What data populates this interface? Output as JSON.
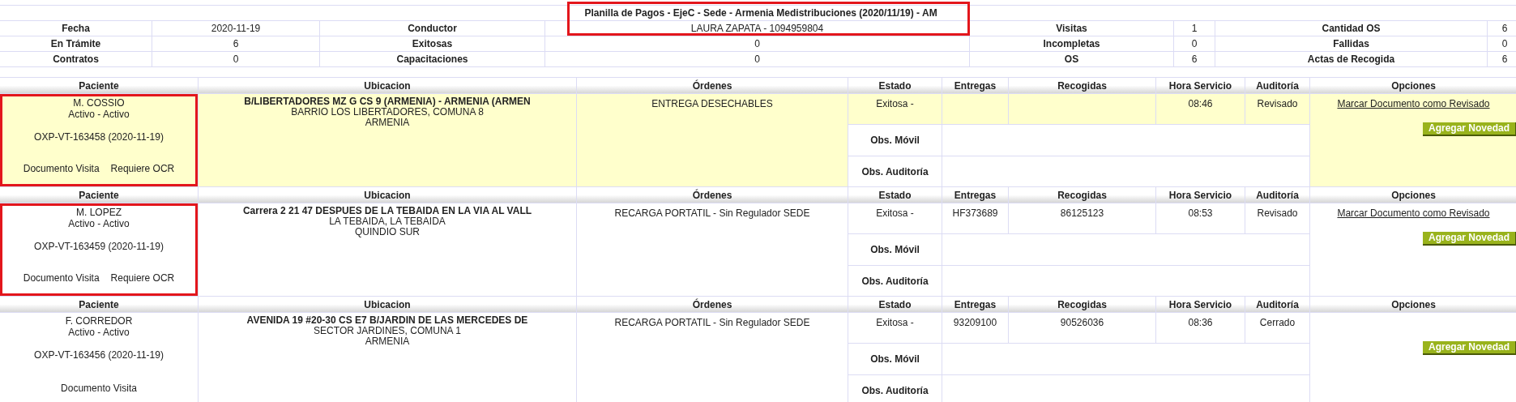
{
  "summary": {
    "title": "Planilla de Pagos - EjeC - Sede - Armenia Medistribuciones (2020/11/19) - AM",
    "flagged": true,
    "rows": [
      [
        {
          "label": "Fecha",
          "value": "2020-11-19"
        },
        {
          "label": "Conductor",
          "value": "LAURA ZAPATA - 1094959804"
        },
        {
          "label": "Visitas",
          "value": "1"
        },
        {
          "label": "Cantidad OS",
          "value": "6"
        }
      ],
      [
        {
          "label": "En Trámite",
          "value": "6"
        },
        {
          "label": "Exitosas",
          "value": "0"
        },
        {
          "label": "Incompletas",
          "value": "0"
        },
        {
          "label": "Fallidas",
          "value": "0"
        }
      ],
      [
        {
          "label": "Contratos",
          "value": "0"
        },
        {
          "label": "Capacitaciones",
          "value": "0"
        },
        {
          "label": "OS",
          "value": "6"
        },
        {
          "label": "Actas de Recogida",
          "value": "6"
        }
      ]
    ]
  },
  "records": [
    {
      "selected": true,
      "flagged": true,
      "columns": [
        "Paciente",
        "Ubicacion",
        "Órdenes",
        "Estado",
        "Entregas",
        "Recogidas",
        "Hora Servicio",
        "Auditoría",
        "Opciones"
      ],
      "patient": {
        "name": "M. COSSIO",
        "status": "Activo - Activo",
        "code": "OXP-VT-163458 (2020-11-19)",
        "documents": [
          "Documento Visita",
          "Requiere OCR"
        ]
      },
      "address": [
        "B/LIBERTADORES MZ G CS 9 (ARMENIA) - ARMENIA (ARMEN",
        "BARRIO LOS LIBERTADORES, COMUNA 8",
        "ARMENIA"
      ],
      "order": "ENTREGA DESECHABLES",
      "estado": "Exitosa -",
      "hora": "08:46",
      "auditoria": "Revisado",
      "obs_labels": [
        "Obs. Móvil",
        "Obs. Auditoría"
      ],
      "link": "Marcar Documento como Revisado",
      "button": "Agregar Novedad"
    },
    {
      "selected": false,
      "flagged": true,
      "columns": [
        "Paciente",
        "Ubicacion",
        "Órdenes",
        "Estado",
        "Entregas",
        "Recogidas",
        "Hora Servicio",
        "Auditoría",
        "Opciones"
      ],
      "patient": {
        "name": "M. LOPEZ",
        "status": "Activo - Activo",
        "code": "OXP-VT-163459 (2020-11-19)",
        "documents": [
          "Documento Visita",
          "Requiere OCR"
        ]
      },
      "address": [
        "Carrera 2 21 47 DESPUES DE LA TEBAIDA EN LA VIA AL VALL",
        "LA TEBAIDA, LA TEBAIDA",
        "QUINDIO SUR"
      ],
      "order": "RECARGA PORTATIL - Sin Regulador SEDE",
      "estado": "Exitosa -",
      "entregas": "HF373689",
      "recogidas": "86125123",
      "hora": "08:53",
      "auditoria": "Revisado",
      "obs_labels": [
        "Obs. Móvil",
        "Obs. Auditoría"
      ],
      "link": "Marcar Documento como Revisado",
      "button": "Agregar Novedad"
    },
    {
      "selected": false,
      "flagged": false,
      "columns": [
        "Paciente",
        "Ubicacion",
        "Órdenes",
        "Estado",
        "Entregas",
        "Recogidas",
        "Hora Servicio",
        "Auditoría",
        "Opciones"
      ],
      "patient": {
        "name": "F. CORREDOR",
        "status": "Activo - Activo",
        "code": "OXP-VT-163456 (2020-11-19)",
        "documents": [
          "Documento Visita"
        ]
      },
      "address": [
        "AVENIDA 19 #20-30 CS E7 B/JARDIN DE LAS MERCEDES DE",
        "SECTOR JARDINES, COMUNA 1",
        "ARMENIA"
      ],
      "order": "RECARGA PORTATIL - Sin Regulador SEDE",
      "estado": "Exitosa -",
      "entregas": "93209100",
      "recogidas": "90526036",
      "hora": "08:36",
      "auditoria": "Cerrado",
      "obs_labels": [
        "Obs. Móvil",
        "Obs. Auditoría"
      ],
      "button": "Agregar Novedad"
    }
  ]
}
